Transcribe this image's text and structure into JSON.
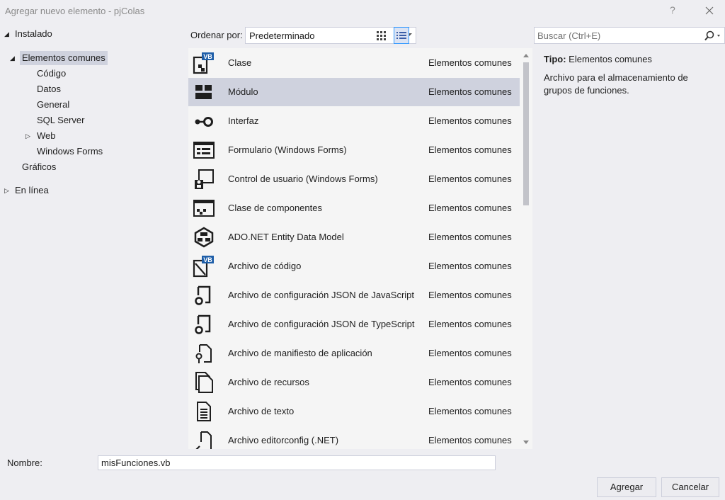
{
  "window": {
    "title": "Agregar nuevo elemento - pjColas",
    "help": "?"
  },
  "tree": {
    "installed": "Instalado",
    "common": "Elementos comunes",
    "children": [
      "Código",
      "Datos",
      "General",
      "SQL Server",
      "Web",
      "Windows Forms"
    ],
    "graphics": "Gráficos",
    "online": "En línea"
  },
  "toolbar": {
    "order_label": "Ordenar por:",
    "order_value": "Predeterminado"
  },
  "search": {
    "placeholder": "Buscar (Ctrl+E)"
  },
  "items": [
    {
      "name": "Clase",
      "category": "Elementos comunes",
      "icon": "class-icon"
    },
    {
      "name": "Módulo",
      "category": "Elementos comunes",
      "icon": "module-icon"
    },
    {
      "name": "Interfaz",
      "category": "Elementos comunes",
      "icon": "interface-icon"
    },
    {
      "name": "Formulario (Windows Forms)",
      "category": "Elementos comunes",
      "icon": "form-icon"
    },
    {
      "name": "Control de usuario (Windows Forms)",
      "category": "Elementos comunes",
      "icon": "user-control-icon"
    },
    {
      "name": "Clase de componentes",
      "category": "Elementos comunes",
      "icon": "component-class-icon"
    },
    {
      "name": "ADO.NET Entity Data Model",
      "category": "Elementos comunes",
      "icon": "entity-model-icon"
    },
    {
      "name": "Archivo de código",
      "category": "Elementos comunes",
      "icon": "code-file-icon"
    },
    {
      "name": "Archivo de configuración JSON de JavaScript",
      "category": "Elementos comunes",
      "icon": "json-config-icon"
    },
    {
      "name": "Archivo de configuración JSON de TypeScript",
      "category": "Elementos comunes",
      "icon": "json-config-icon"
    },
    {
      "name": "Archivo de manifiesto de aplicación",
      "category": "Elementos comunes",
      "icon": "manifest-icon"
    },
    {
      "name": "Archivo de recursos",
      "category": "Elementos comunes",
      "icon": "resource-file-icon"
    },
    {
      "name": "Archivo de texto",
      "category": "Elementos comunes",
      "icon": "text-file-icon"
    },
    {
      "name": "Archivo editorconfig (.NET)",
      "category": "Elementos comunes",
      "icon": "editorconfig-icon"
    }
  ],
  "selected_item": "Módulo",
  "details": {
    "type_label": "Tipo:",
    "type_value": "Elementos comunes",
    "description": "Archivo para el almacenamiento de grupos de funciones."
  },
  "footer": {
    "name_label": "Nombre:",
    "name_value": "misFunciones.vb",
    "add_button": "Agregar",
    "cancel_button": "Cancelar"
  },
  "colors": {
    "selection": "#cfd2de",
    "accent": "#3399ff",
    "vb_badge": "#1e5ea8",
    "background": "#eeeef2"
  }
}
